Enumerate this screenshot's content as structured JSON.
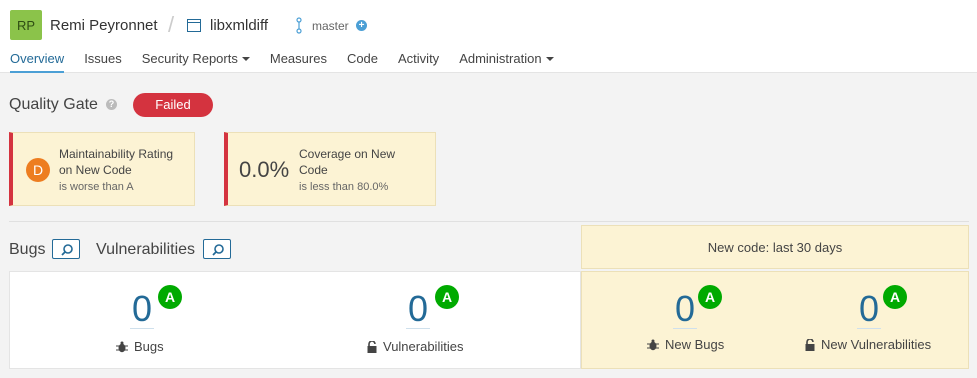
{
  "header": {
    "avatar": "RP",
    "org": "Remi Peyronnet",
    "project": "libxmldiff",
    "branch": "master"
  },
  "nav": {
    "items": [
      {
        "label": "Overview"
      },
      {
        "label": "Issues"
      },
      {
        "label": "Security Reports"
      },
      {
        "label": "Measures"
      },
      {
        "label": "Code"
      },
      {
        "label": "Activity"
      },
      {
        "label": "Administration"
      }
    ]
  },
  "quality_gate": {
    "title": "Quality Gate",
    "status": "Failed",
    "conditions": [
      {
        "rating": "D",
        "label": "Maintainability Rating on New Code",
        "sub": "is worse than A"
      },
      {
        "value": "0.0%",
        "label": "Coverage on New Code",
        "sub": "is less than 80.0%"
      }
    ]
  },
  "section": {
    "bugs": "Bugs",
    "vulnerabilities": "Vulnerabilities",
    "new_code": "New code: last 30 days"
  },
  "metrics": {
    "bugs": {
      "value": "0",
      "rating": "A",
      "label": "Bugs"
    },
    "vulnerabilities": {
      "value": "0",
      "rating": "A",
      "label": "Vulnerabilities"
    },
    "new_bugs": {
      "value": "0",
      "rating": "A",
      "label": "New Bugs"
    },
    "new_vulnerabilities": {
      "value": "0",
      "rating": "A",
      "label": "New Vulnerabilities"
    }
  },
  "colors": {
    "failed": "#d4333f",
    "rating_a": "#00aa00",
    "rating_d": "#ed7d20",
    "link": "#236a97",
    "new_code_bg": "#fcf3d4"
  }
}
